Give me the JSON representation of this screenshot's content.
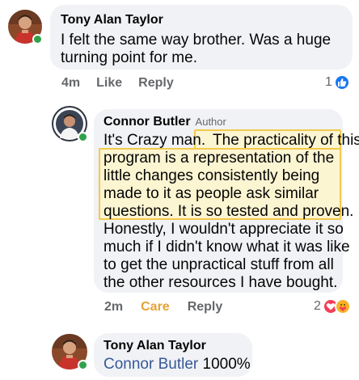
{
  "comments": [
    {
      "author": "Tony Alan Taylor",
      "lines": [
        "I felt the same way brother. Was a huge",
        "turning point for me."
      ],
      "time": "4m",
      "like_label": "Like",
      "reply_label": "Reply",
      "reaction_count": "1",
      "reaction_type": "like-icon"
    },
    {
      "author": "Connor Butler",
      "badge": "Author",
      "line1_plain": "It's Crazy man.",
      "line1_highlight": "The practicality of this",
      "highlight_lines": [
        "program is a representation of the",
        "little changes consistently being",
        "made to it as people ask similar",
        "questions. It is so tested and proven."
      ],
      "rest_lines": [
        "Honestly, I wouldn't appreciate it so",
        "much if I didn't know what it was like",
        "to get the unpractical stuff from all",
        "the other resources I have bought."
      ],
      "time": "2m",
      "care_label": "Care",
      "reply_label": "Reply",
      "reaction_count": "2",
      "reaction_types": [
        "love-icon",
        "care-icon"
      ]
    },
    {
      "author": "Tony Alan Taylor",
      "mention": "Connor Butler",
      "text": "1000%"
    }
  ],
  "colors": {
    "bubble": "#f0f2f5",
    "online": "#31a24c",
    "like_blue": "#1877f2",
    "love_red": "#f33e58",
    "care_yellow": "#f7b125",
    "care_label": "#e5a235",
    "highlight_border": "#f2c94c",
    "highlight_fill": "#fcf5d2"
  }
}
